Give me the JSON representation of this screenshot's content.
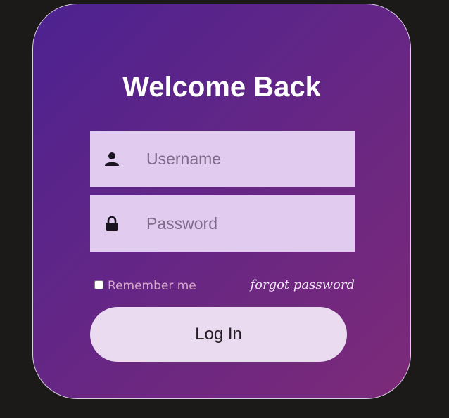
{
  "login": {
    "title": "Welcome Back",
    "username": {
      "placeholder": "Username",
      "value": "",
      "icon": "user-icon"
    },
    "password": {
      "placeholder": "Password",
      "value": "",
      "icon": "lock-icon"
    },
    "remember_label": "Remember me",
    "remember_checked": false,
    "forgot_label": "forgot password",
    "submit_label": "Log In"
  },
  "colors": {
    "page_background": "#1b1a18",
    "card_gradient_start": "#4c2290",
    "card_gradient_end": "#7d2a78",
    "field_background": "#e1cbee",
    "button_background": "#eadbf1",
    "title_text": "#ffffff"
  }
}
